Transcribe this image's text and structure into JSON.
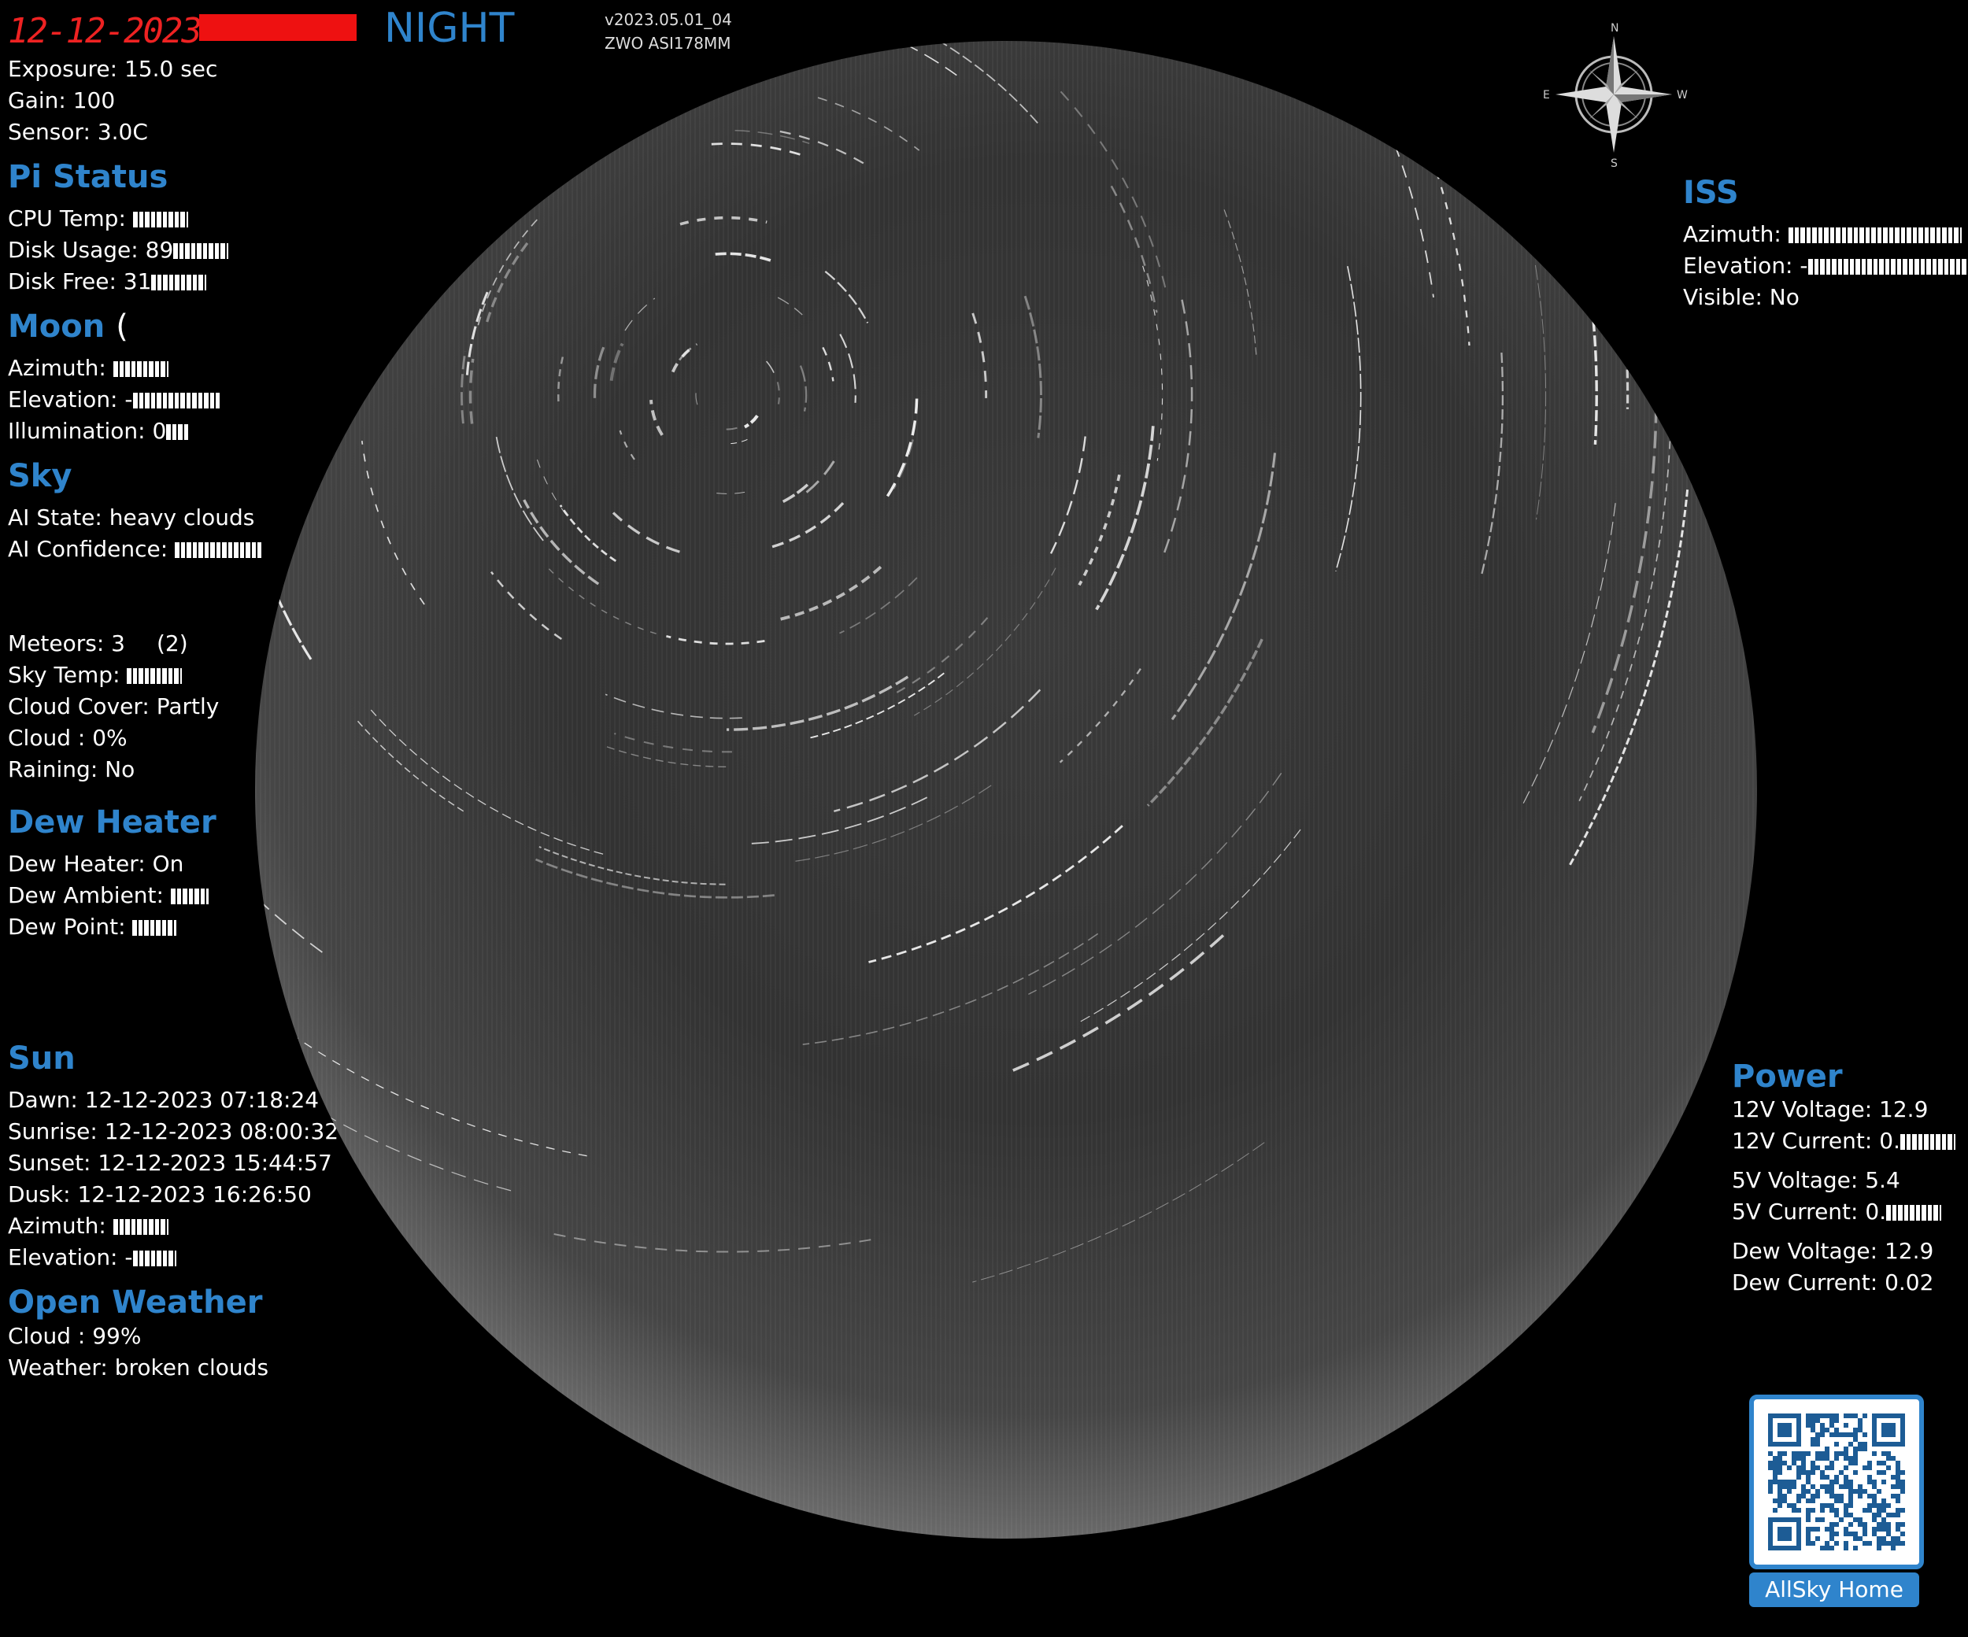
{
  "header": {
    "timestamp": "12-12-2023 ",
    "mode": "NIGHT",
    "version": "v2023.05.01_04",
    "camera": "ZWO ASI178MM"
  },
  "camera_info": {
    "exposure": "Exposure: 15.0 sec",
    "gain_label": "Gain: ",
    "gain_value": "100",
    "sensor_label": "Sensor: ",
    "sensor_value": "3.0C"
  },
  "pi_status": {
    "title": "Pi Status",
    "cpu_label": "CPU Temp: ",
    "disk_usage_label": "Disk Usage: ",
    "disk_usage_value": "89",
    "disk_free_label": "Disk Free: ",
    "disk_free_value": "31"
  },
  "moon": {
    "title": "Moon",
    "symbol": "(",
    "azimuth_label": "Azimuth: ",
    "elevation_label": "Elevation: ",
    "elevation_value": "-",
    "illumination_label": "Illumination: ",
    "illumination_value": "0"
  },
  "sky": {
    "title": "Sky",
    "ai_state_label": "AI State: ",
    "ai_state_value": "heavy clouds",
    "ai_confidence_label": "AI Confidence: ",
    "meteors_label": "Meteors: ",
    "meteors_value": "3",
    "meteors_paren": "(2)",
    "sky_temp_label": "Sky Temp: ",
    "cloud_cover_label": "Cloud Cover: ",
    "cloud_cover_value": "Partly",
    "cloud_label": "Cloud : 0%",
    "raining": "Raining: No"
  },
  "dew_heater": {
    "title": "Dew Heater",
    "state": "Dew Heater: On",
    "ambient_label": "Dew Ambient: ",
    "point_label": "Dew Point: "
  },
  "sun": {
    "title": "Sun",
    "dawn_label": "Dawn: ",
    "dawn_value": "12-12-2023 07:18:24",
    "sunrise_label": "Sunrise: ",
    "sunrise_value": "12-12-2023 08:00:32",
    "sunset_label": "Sunset: ",
    "sunset_value": "12-12-2023 15:44:57",
    "dusk_label": "Dusk: ",
    "dusk_value": "12-12-2023 16:26:50",
    "azimuth_label": "Azimuth: ",
    "elevation_label": "Elevation: ",
    "elevation_value": "-"
  },
  "open_weather": {
    "title": "Open Weather",
    "cloud_label": "Cloud : ",
    "cloud_value": "99%",
    "weather_label": "Weather: ",
    "weather_value": "broken clouds"
  },
  "iss": {
    "title": "ISS",
    "azimuth_label": "Azimuth: ",
    "elevation_label": "Elevation: ",
    "elevation_value": "-",
    "visible": "Visible: No"
  },
  "power": {
    "title": "Power",
    "v12_label": "12V Voltage: ",
    "v12_value": "12.9",
    "c12_label": "12V Current: ",
    "c12_value": "0.",
    "v5_label": "5V Voltage: ",
    "v5_value": "5.4",
    "c5_label": "5V Current: ",
    "c5_value": "0.",
    "dew_v_label": "Dew Voltage: ",
    "dew_v_value": "12.9",
    "dew_c_label": "Dew Current: ",
    "dew_c_value": "0.02"
  },
  "compass": {
    "n": "N",
    "s": "S",
    "e": "E",
    "w": "W"
  },
  "qr": {
    "label": "AllSky Home"
  },
  "colors": {
    "accent": "#2f84cc",
    "timestamp": "#e22222"
  }
}
